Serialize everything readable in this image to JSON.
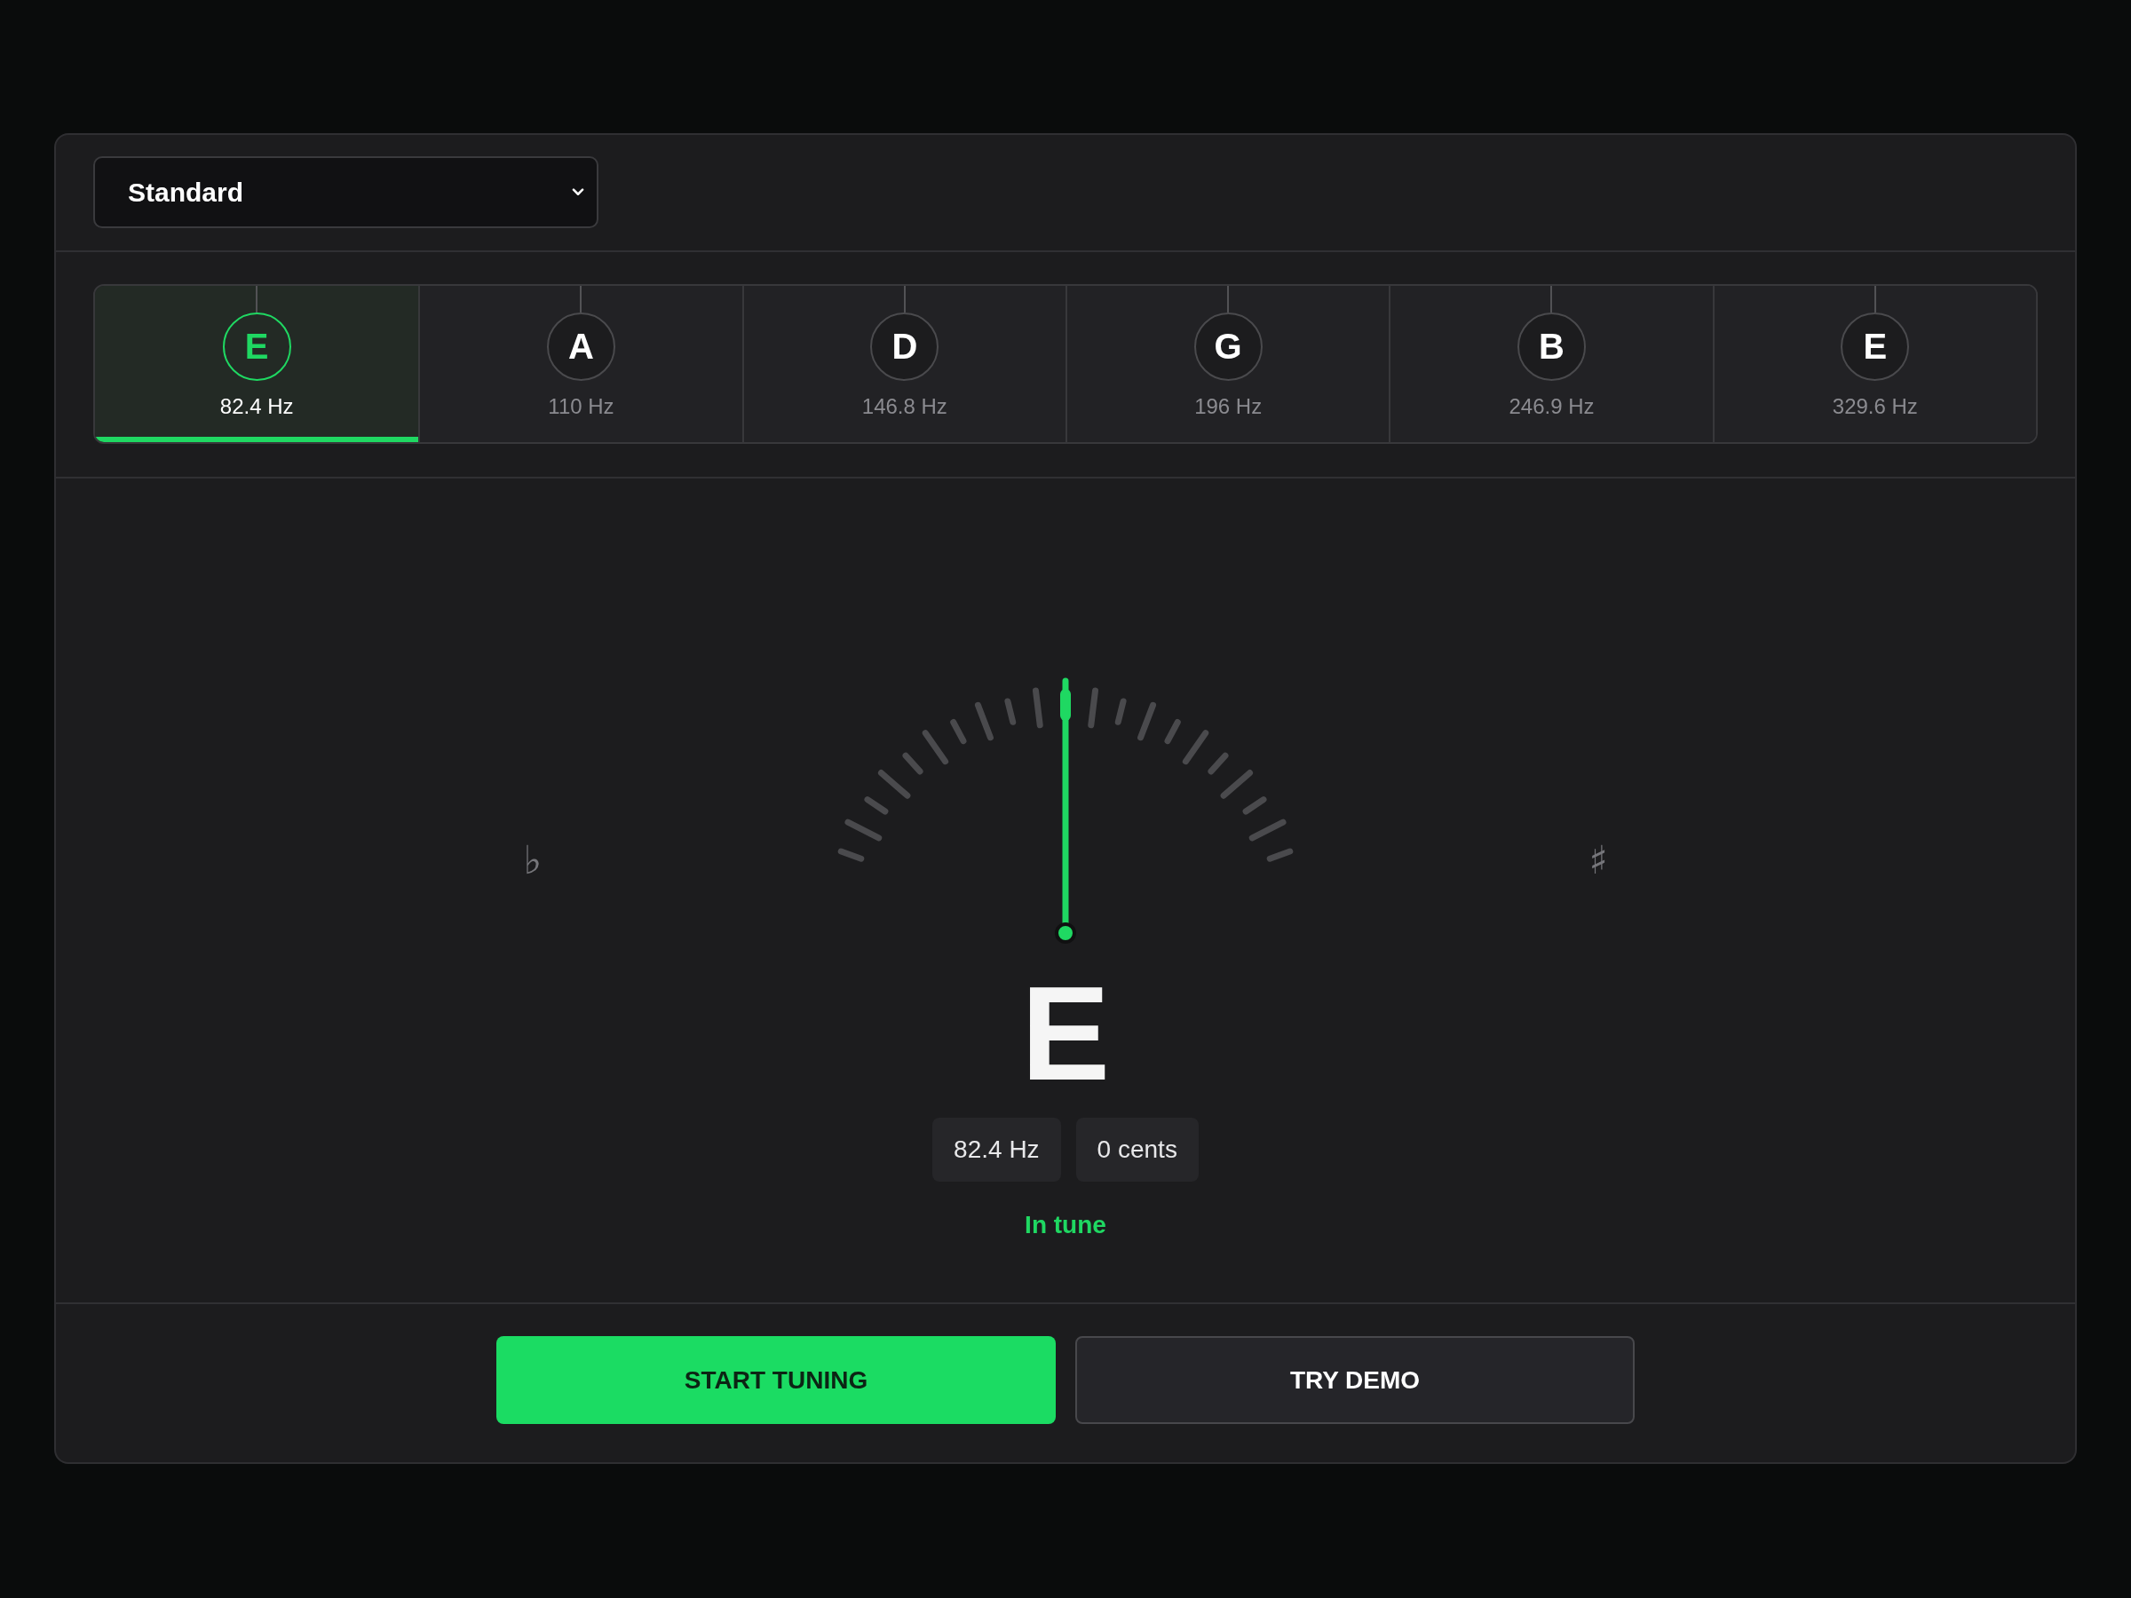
{
  "tuning_select": {
    "value": "Standard"
  },
  "strings": [
    {
      "note": "E",
      "frequency": "82.4 Hz",
      "selected": true
    },
    {
      "note": "A",
      "frequency": "110 Hz",
      "selected": false
    },
    {
      "note": "D",
      "frequency": "146.8 Hz",
      "selected": false
    },
    {
      "note": "G",
      "frequency": "196 Hz",
      "selected": false
    },
    {
      "note": "B",
      "frequency": "246.9 Hz",
      "selected": false
    },
    {
      "note": "E",
      "frequency": "329.6 Hz",
      "selected": false
    }
  ],
  "meter": {
    "flat_symbol": "♭",
    "sharp_symbol": "♯",
    "level": 0.5,
    "in_tune": true
  },
  "reading": {
    "note": "E",
    "frequency": "82.4 Hz",
    "cents": "0 cents",
    "status": "In tune"
  },
  "buttons": [
    {
      "label": "START TUNING",
      "kind": "primary"
    },
    {
      "label": "TRY DEMO",
      "kind": "secondary"
    }
  ]
}
